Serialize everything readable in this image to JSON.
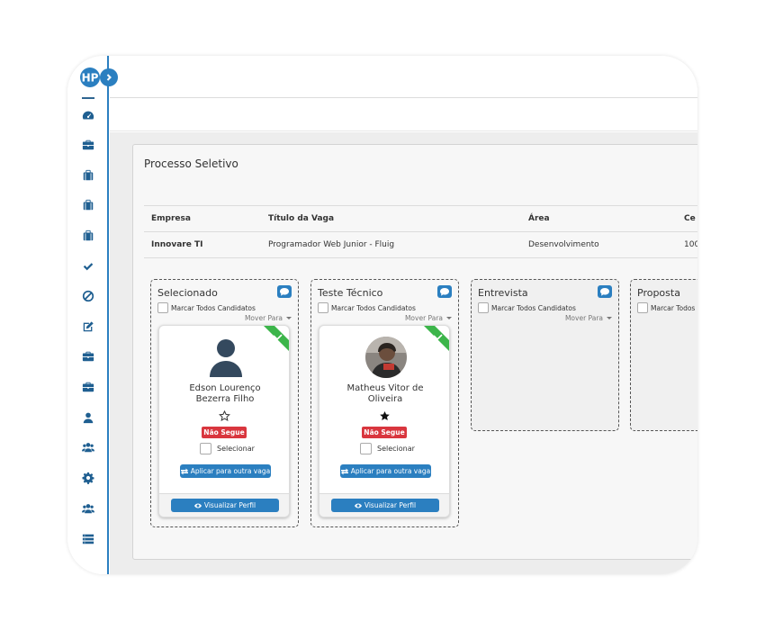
{
  "panel": {
    "title": "Processo Seletivo"
  },
  "job_table": {
    "headers": [
      "Empresa",
      "Título da Vaga",
      "Área",
      "Ce"
    ],
    "row": [
      "Innovare TI",
      "Programador Web Junior - Fluig",
      "Desenvolvimento",
      "100"
    ]
  },
  "columns": [
    {
      "title": "Selecionado",
      "mark_all_label": "Marcar Todos Candidatos",
      "move_to_label": "Mover Para",
      "candidate": {
        "name_line1": "Edson Lourenço",
        "name_line2": "Bezerra Filho",
        "avatar": "person-placeholder-icon",
        "starred": false,
        "status_badge": "Não Segue",
        "select_label": "Selecionar",
        "apply_button": "Aplicar para outra vaga",
        "view_button": "Visualizar Perfil"
      }
    },
    {
      "title": "Teste Técnico",
      "mark_all_label": "Marcar Todos Candidatos",
      "move_to_label": "Mover Para",
      "candidate": {
        "name_line1": "Matheus Vitor de",
        "name_line2": "Oliveira",
        "avatar": "photo",
        "starred": true,
        "status_badge": "Não Segue",
        "select_label": "Selecionar",
        "apply_button": "Aplicar para outra vaga",
        "view_button": "Visualizar Perfil"
      }
    },
    {
      "title": "Entrevista",
      "mark_all_label": "Marcar Todos Candidatos",
      "move_to_label": "Mover Para"
    },
    {
      "title": "Proposta",
      "mark_all_label": "Marcar Todos"
    }
  ],
  "sidebar": {
    "icons": [
      "dashboard-icon",
      "briefcase-icon",
      "suitcase-icon",
      "suitcase-icon",
      "suitcase-icon",
      "check-icon",
      "ban-icon",
      "edit-icon",
      "briefcase-icon",
      "briefcase-icon",
      "user-icon",
      "users-icon",
      "gear-icon",
      "users-icon",
      "list-icon"
    ]
  },
  "colors": {
    "primary": "#2b7fc0",
    "badge": "#d9363e",
    "ribbon": "#3cb54a",
    "sidebar_icon": "#1f5f91"
  }
}
